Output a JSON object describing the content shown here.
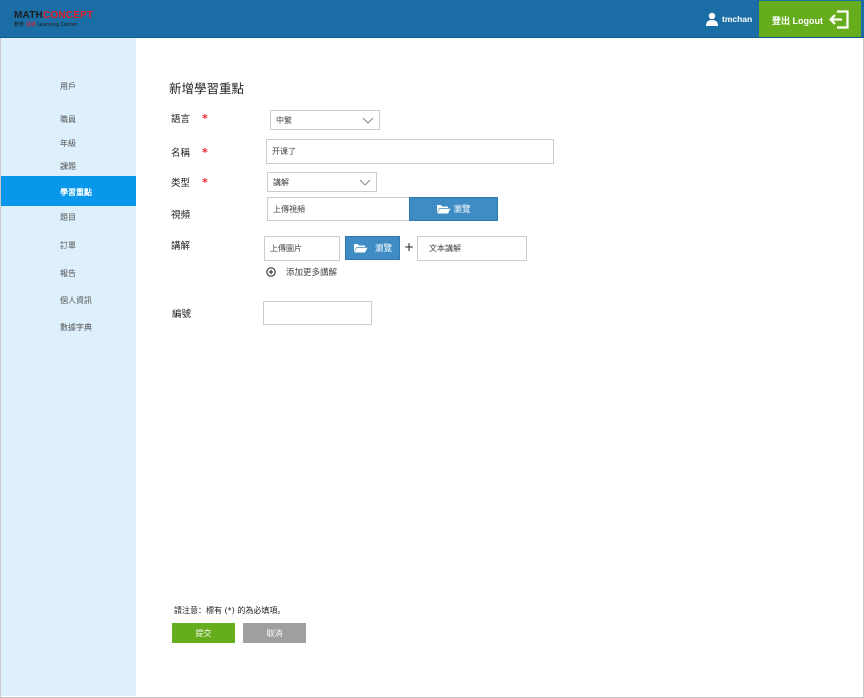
{
  "header": {
    "logo": {
      "math": "MATH",
      "concept": "CONCEPT",
      "sub_left": "數學",
      "sub_mid": "思維",
      "sub_right": "Learning Center"
    },
    "username": "tmchan",
    "logout_label": "登出 Logout",
    "colors": {
      "bar": "#1a6ea5",
      "logout": "#66ad1e"
    }
  },
  "sidebar": {
    "items": [
      {
        "label": "用戶"
      },
      {
        "label": "職員"
      },
      {
        "label": "年級"
      },
      {
        "label": "課題"
      },
      {
        "label": "學習重點",
        "active": true
      },
      {
        "label": "題目"
      },
      {
        "label": "訂單"
      },
      {
        "label": "報告"
      },
      {
        "label": "個人資訊"
      },
      {
        "label": "數據字典"
      }
    ],
    "colors": {
      "background": "#ddf0fc",
      "active": "#0897ea"
    }
  },
  "form": {
    "title": "新增學習重點",
    "language": {
      "label": "語言",
      "required": "*",
      "value": "中繁"
    },
    "name": {
      "label": "名稱",
      "required": "*",
      "value": "开课了"
    },
    "type": {
      "label": "类型",
      "required": "*",
      "value": "講解"
    },
    "video": {
      "label": "視頻",
      "placeholder": "上傳視頻",
      "browse_label": "瀏覽"
    },
    "explain": {
      "label": "講解",
      "upload_placeholder": "上傳圖片",
      "browse_label": "瀏覽",
      "plus": "+",
      "text_placeholder": "文本講解",
      "add_more": "添加更多講解"
    },
    "number": {
      "label": "編號",
      "value": ""
    },
    "note": "請注意：標有 (*) 的為必填項。",
    "submit_label": "提交",
    "cancel_label": "取消",
    "colors": {
      "required": "#e8222a",
      "browse": "#3e8cc3",
      "submit": "#66ad1e",
      "cancel": "#9f9f9f"
    }
  }
}
